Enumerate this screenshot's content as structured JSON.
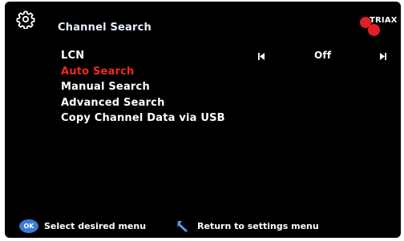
{
  "header": {
    "title": "Channel Search",
    "brand": "TRIAX",
    "icon": "gear-icon"
  },
  "menu": {
    "items": [
      {
        "label": "LCN",
        "active": false
      },
      {
        "label": "Auto Search",
        "active": true
      },
      {
        "label": "Manual Search",
        "active": false
      },
      {
        "label": "Advanced Search",
        "active": false
      },
      {
        "label": "Copy Channel Data via USB",
        "active": false
      }
    ],
    "lcn_value": "Off"
  },
  "footer": {
    "ok_label": "OK",
    "select_hint": "Select desired menu",
    "return_hint": "Return to settings menu"
  },
  "colors": {
    "background": "#000000",
    "active_item": "#ee2a1c",
    "text": "#ffffff",
    "brand_red": "#e21e26",
    "ok_button": "#3a7bd5"
  }
}
